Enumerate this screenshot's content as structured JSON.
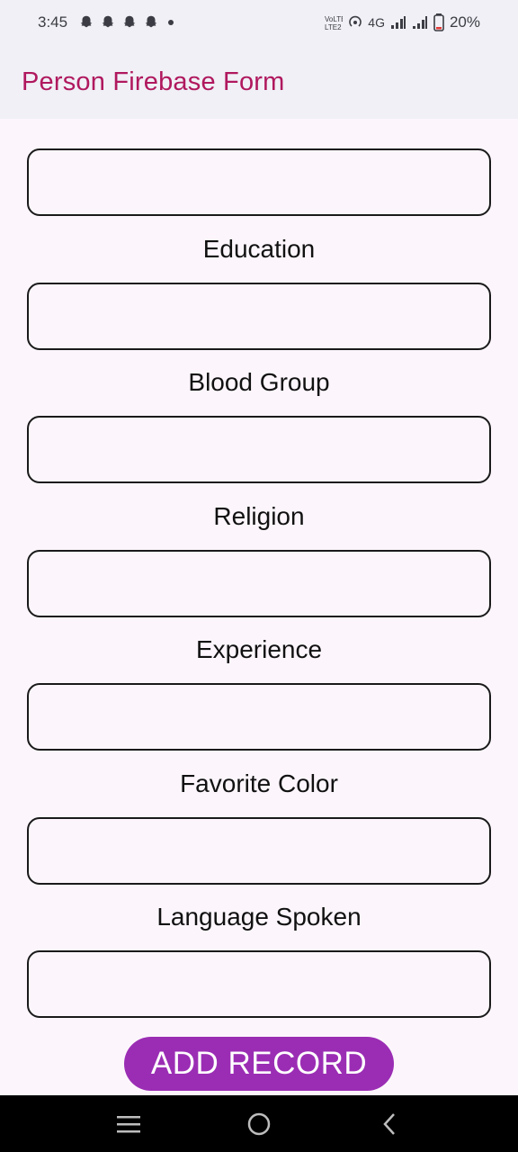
{
  "status_bar": {
    "time": "3:45",
    "network_label": "4G",
    "volte_label": "Vo))\nLTE2",
    "battery": "20%"
  },
  "app_bar": {
    "title": "Person  Firebase Form"
  },
  "form": {
    "fields": [
      {
        "label": "",
        "value": ""
      },
      {
        "label": "Education",
        "value": ""
      },
      {
        "label": "Blood Group",
        "value": ""
      },
      {
        "label": "Religion",
        "value": ""
      },
      {
        "label": "Experience",
        "value": ""
      },
      {
        "label": "Favorite Color",
        "value": ""
      },
      {
        "label": "Language Spoken",
        "value": ""
      }
    ],
    "submit_label": "ADD RECORD"
  },
  "nav_bar": {
    "icons": [
      "recent-apps-icon",
      "home-icon",
      "back-icon"
    ]
  },
  "colors": {
    "accent": "#9b2db4",
    "title": "#b0185e",
    "background": "#fcf6fc"
  }
}
